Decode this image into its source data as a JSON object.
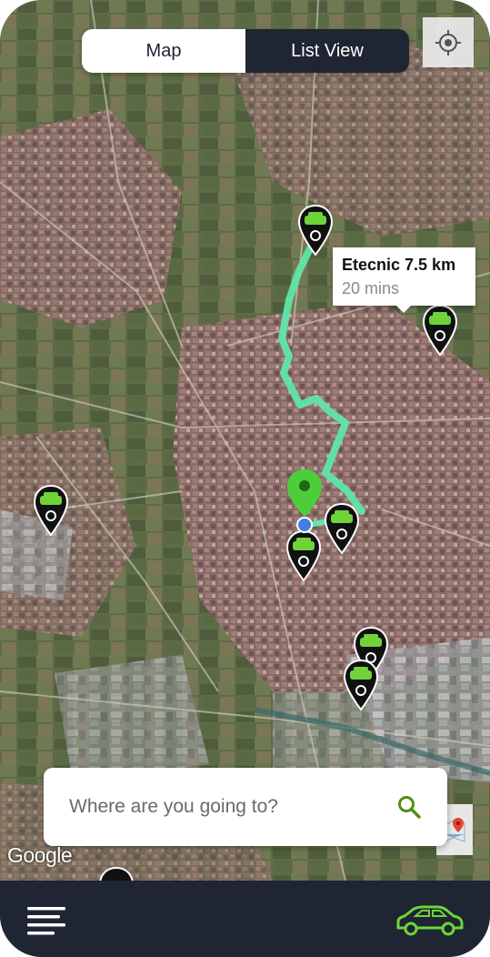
{
  "toggle": {
    "map_label": "Map",
    "list_label": "List View",
    "active": "Map"
  },
  "callout": {
    "title": "Etecnic 7.5 km",
    "subtitle": "20 mins"
  },
  "search": {
    "placeholder": "Where are you going to?"
  },
  "map_attribution": "Google",
  "icons": {
    "locate": "crosshair-location-icon",
    "search": "search-icon",
    "google_maps": "google-maps-icon",
    "menu": "hamburger-menu-icon",
    "car": "car-icon",
    "charger_pin": "car-charger-pin-icon",
    "destination_pin": "green-map-pin-icon"
  },
  "colors": {
    "route": "#5fe6a8",
    "accent_green": "#66cc22",
    "dark_bar": "#1f2532",
    "user_location": "#3f7fe0",
    "destination_pin": "#4cce3a"
  }
}
